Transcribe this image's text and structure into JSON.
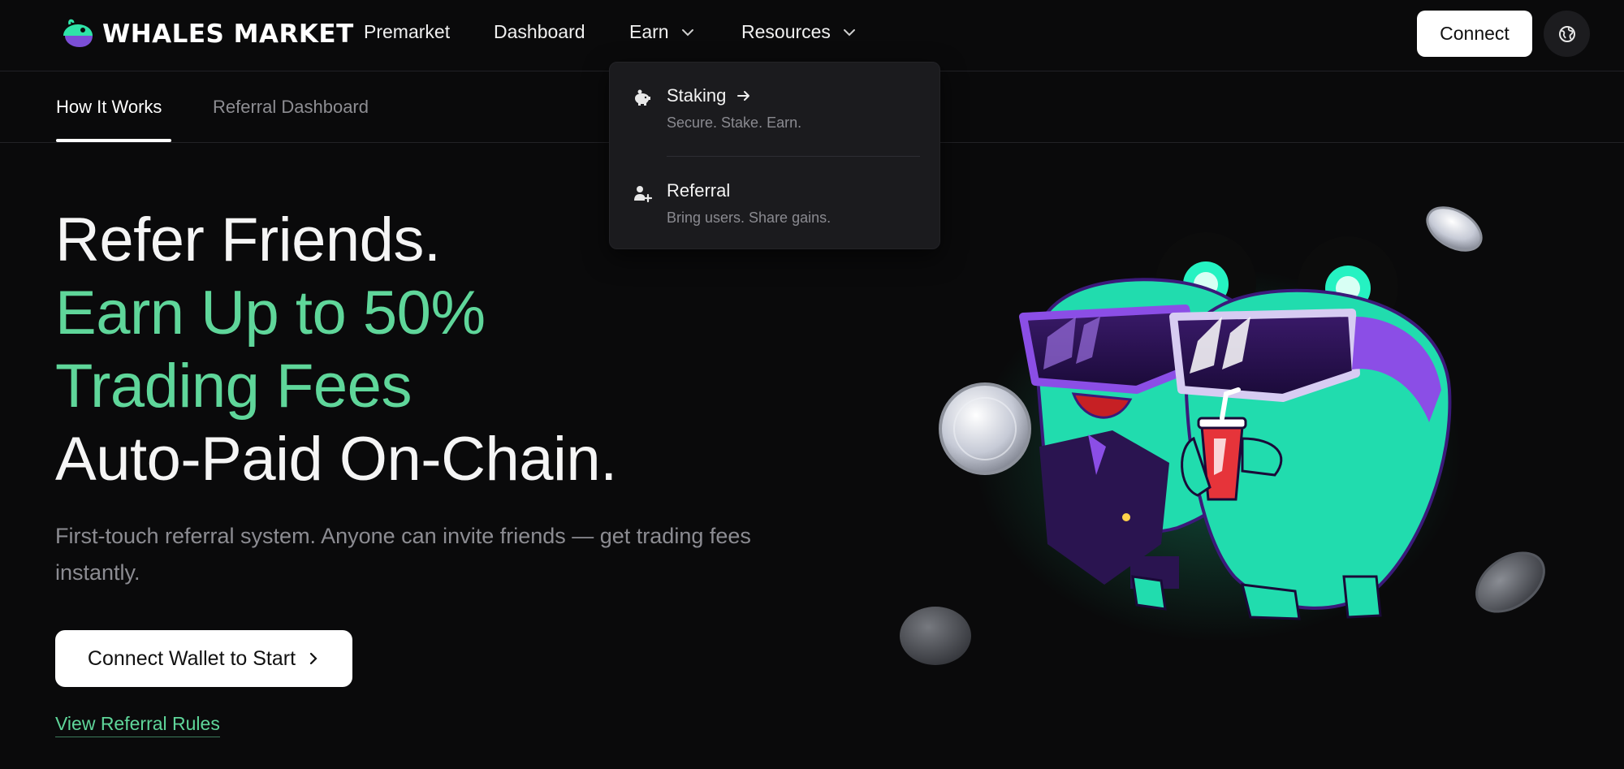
{
  "brand": {
    "name": "WHALES MARKET",
    "logo_icon": "whale-logo-icon"
  },
  "nav": {
    "premarket": "Premarket",
    "dashboard": "Dashboard",
    "earn": "Earn",
    "resources": "Resources",
    "connect": "Connect",
    "globe_icon": "globe-icon"
  },
  "subnav": {
    "tabs": [
      {
        "label": "How It Works",
        "active": true
      },
      {
        "label": "Referral Dashboard",
        "active": false
      }
    ]
  },
  "earn_menu": {
    "items": [
      {
        "title": "Staking",
        "subtitle": "Secure. Stake. Earn.",
        "icon": "piggy-bank-icon",
        "has_arrow": true
      },
      {
        "title": "Referral",
        "subtitle": "Bring users. Share gains.",
        "icon": "user-plus-icon",
        "has_arrow": false
      }
    ]
  },
  "hero": {
    "line1": "Refer Friends.",
    "line2": "Earn Up to 50%",
    "line3": "Trading Fees",
    "line4": "Auto-Paid On-Chain.",
    "description": "First-touch referral system. Anyone can invite friends — get trading fees instantly.",
    "cta": "Connect Wallet to Start",
    "rules_link": "View Referral Rules"
  },
  "colors": {
    "background": "#0a0a0b",
    "accent_green": "#5fd69a",
    "dropdown_bg": "#1b1b1e",
    "mascot_teal": "#1fe0b0",
    "mascot_purple": "#8b4ee6"
  }
}
